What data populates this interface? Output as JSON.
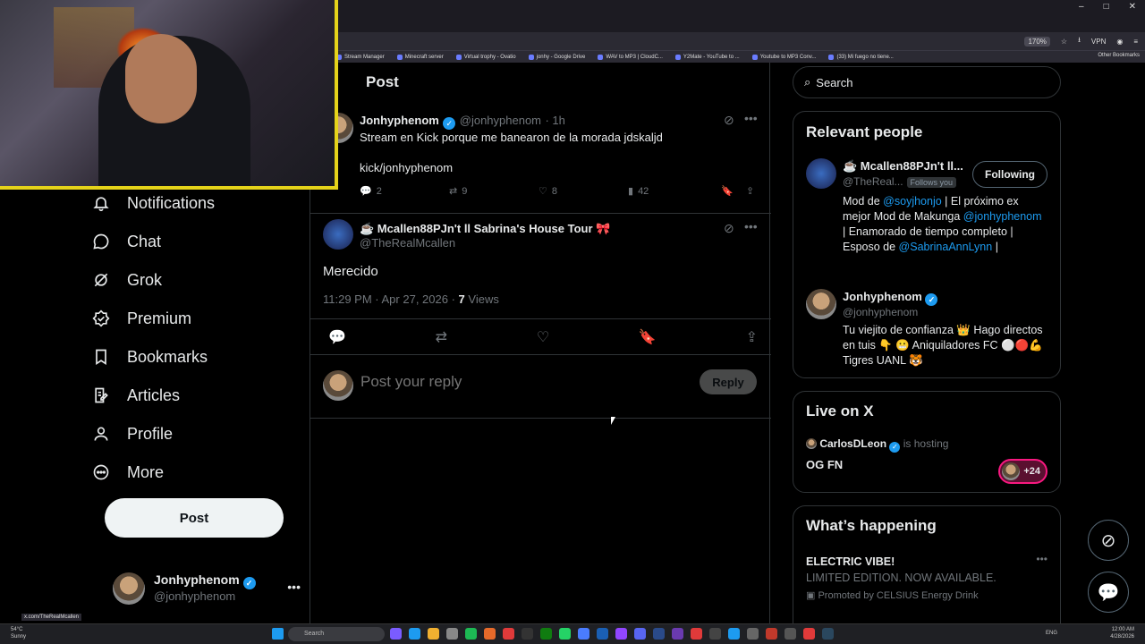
{
  "browser": {
    "zoom": "170%",
    "vpn_label": "VPN",
    "window_controls": [
      "–",
      "□",
      "✕"
    ],
    "bookmarks": [
      "Stream Manager",
      "Minecraft server",
      "Virtual trophy - Ovatio",
      "jonhy - Google Drive",
      "WAV to MP3 | CloudC...",
      "Y2Mate - YouTube to ...",
      "Youtube to MP3 Conv...",
      "(33) Mi fuego no tiene..."
    ],
    "other_bookmarks": "Other Bookmarks",
    "status_url": "x.com/TheRealMcallen"
  },
  "nav": {
    "items": [
      {
        "label": "Notifications",
        "icon": "bell-icon"
      },
      {
        "label": "Chat",
        "icon": "chat-icon"
      },
      {
        "label": "Grok",
        "icon": "grok-icon"
      },
      {
        "label": "Premium",
        "icon": "premium-icon"
      },
      {
        "label": "Bookmarks",
        "icon": "bookmark-icon"
      },
      {
        "label": "Articles",
        "icon": "articles-icon"
      },
      {
        "label": "Profile",
        "icon": "person-icon"
      },
      {
        "label": "More",
        "icon": "more-circle-icon"
      }
    ],
    "post_button": "Post",
    "account": {
      "name": "Jonhyphenom",
      "handle": "@jonhyphenom"
    }
  },
  "main": {
    "header": "Post",
    "original_tweet": {
      "name": "Jonhyphenom",
      "handle": "@jonhyphenom",
      "time": "· 1h",
      "line1": "Stream en Kick porque me banearon de la morada jdskaljd",
      "line2": "kick/jonhyphenom",
      "replies": "2",
      "reposts": "9",
      "likes": "8",
      "views": "42"
    },
    "reply_tweet": {
      "name": "☕ Mcallen88PJn't ll Sabrina's House Tour 🎀",
      "handle": "@TheRealMcallen",
      "text": "Merecido",
      "timestamp": "11:29 PM · Apr 27, 2026 ·",
      "views_count": "7",
      "views_label": "Views"
    },
    "composer": {
      "placeholder": "Post your reply",
      "reply_button": "Reply"
    }
  },
  "sidebar": {
    "search_placeholder": "Search",
    "relevant": {
      "title": "Relevant people",
      "people": [
        {
          "name": "☕ Mcallen88PJn't ll...",
          "handle": "@TheReal...",
          "follows_you": "Follows you",
          "button": "Following",
          "bio_1": "Mod de ",
          "bio_mention1": "@soyjhonjo",
          "bio_2": " | El próximo ex mejor Mod de Makunga ",
          "bio_mention2": "@jonhyphenom",
          "bio_3": " | Enamorado de tiempo completo | Esposo de ",
          "bio_mention3": "@SabrinaAnnLynn",
          "bio_4": " |"
        },
        {
          "name": "Jonhyphenom",
          "handle": "@jonhyphenom",
          "bio": "Tu viejito de confianza 👑 Hago directos en tuis 👇 😬 Aniquiladores FC ⚪🔴💪 Tigres UANL 🐯"
        }
      ]
    },
    "live": {
      "title": "Live on X",
      "host": "CarlosDLeon",
      "hosting": "is hosting",
      "space": "OG FN",
      "count": "+24"
    },
    "happening": {
      "title": "What’s happening",
      "headline": "ELECTRIC VIBE!",
      "sub": "LIMITED EDITION. NOW AVAILABLE.",
      "promoted": "Promoted by CELSIUS Energy Drink"
    }
  },
  "taskbar": {
    "temp": "54°C",
    "weather": "Sunny",
    "search": "Search",
    "lang": "ENG",
    "time": "12:00 AM",
    "date": "4/28/2026"
  }
}
